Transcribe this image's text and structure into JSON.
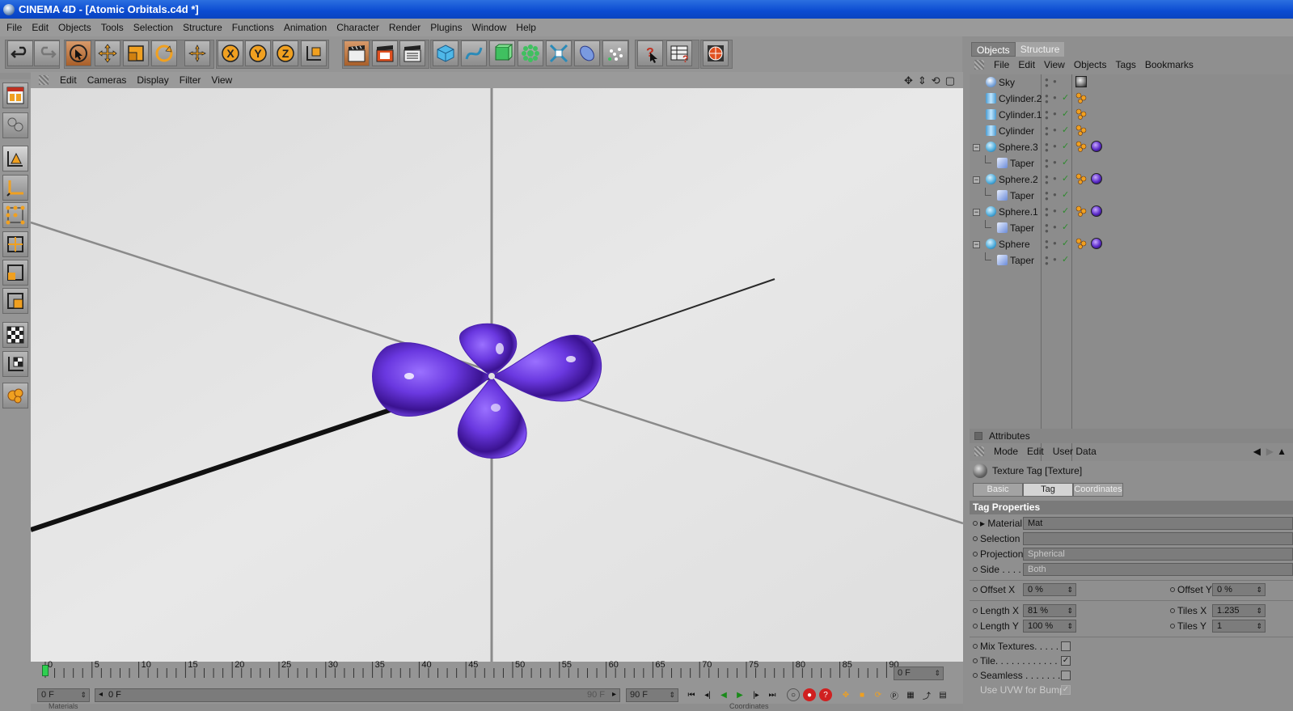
{
  "window": {
    "title": "CINEMA 4D - [Atomic Orbitals.c4d *]"
  },
  "menu": [
    "File",
    "Edit",
    "Objects",
    "Tools",
    "Selection",
    "Structure",
    "Functions",
    "Animation",
    "Character",
    "Render",
    "Plugins",
    "Window",
    "Help"
  ],
  "viewport": {
    "menu": [
      "Edit",
      "Cameras",
      "Display",
      "Filter",
      "View"
    ],
    "nav_icons": [
      "move-view-icon",
      "dolly-view-icon",
      "rotate-view-icon",
      "maximize-view-icon"
    ]
  },
  "timeline": {
    "ticks": [
      "0",
      "5",
      "10",
      "15",
      "20",
      "25",
      "30",
      "35",
      "40",
      "45",
      "50",
      "55",
      "60",
      "65",
      "70",
      "75",
      "80",
      "85",
      "90"
    ],
    "current_frame": "0 F",
    "start_field": "0 F",
    "range_start": "0 F",
    "range_end": "90 F",
    "end_field": "90 F"
  },
  "objects_panel": {
    "tabs": [
      "Objects",
      "Structure"
    ],
    "menu": [
      "File",
      "Edit",
      "View",
      "Objects",
      "Tags",
      "Bookmarks"
    ],
    "rows": [
      {
        "name": "Sky",
        "type": "sky"
      },
      {
        "name": "Cylinder.2",
        "type": "cylinder"
      },
      {
        "name": "Cylinder.1",
        "type": "cylinder"
      },
      {
        "name": "Cylinder",
        "type": "cylinder"
      },
      {
        "name": "Sphere.3",
        "type": "sphere"
      },
      {
        "name": "Taper",
        "type": "taper"
      },
      {
        "name": "Sphere.2",
        "type": "sphere"
      },
      {
        "name": "Taper",
        "type": "taper"
      },
      {
        "name": "Sphere.1",
        "type": "sphere"
      },
      {
        "name": "Taper",
        "type": "taper"
      },
      {
        "name": "Sphere",
        "type": "sphere"
      },
      {
        "name": "Taper",
        "type": "taper"
      }
    ]
  },
  "attributes": {
    "header": "Attributes",
    "menu": [
      "Mode",
      "Edit",
      "User Data"
    ],
    "title": "Texture Tag [Texture]",
    "tabs": [
      "Basic",
      "Tag",
      "Coordinates"
    ],
    "active_tab": "Tag",
    "section": "Tag Properties",
    "material_label": "Material",
    "material_value": "Mat",
    "selection_label": "Selection",
    "selection_value": "",
    "projection_label": "Projection",
    "projection_value": "Spherical",
    "side_label": "Side . . . .",
    "side_value": "Both",
    "offset_x_label": "Offset X",
    "offset_x_value": "0 %",
    "offset_y_label": "Offset Y",
    "offset_y_value": "0 %",
    "length_x_label": "Length X",
    "length_x_value": "81 %",
    "tiles_x_label": "Tiles X",
    "tiles_x_value": "1.235",
    "length_y_label": "Length Y",
    "length_y_value": "100 %",
    "tiles_y_label": "Tiles Y",
    "tiles_y_value": "1",
    "mix_textures_label": "Mix Textures. . . . . . .",
    "tile_label": "Tile. . . . . . . . . . . . .",
    "seamless_label": "Seamless . . . . . . . .",
    "use_uvw_label": "Use UVW for Bump",
    "mix_textures_checked": false,
    "tile_checked": true,
    "seamless_checked": false,
    "use_uvw_checked": true
  },
  "bottom": {
    "left_label": "Materials",
    "right_label": "Coordinates"
  },
  "colors": {
    "orbital": "#5a2bc8",
    "titlebar": "#0b4bd1",
    "accent_orange": "#f0a020"
  }
}
